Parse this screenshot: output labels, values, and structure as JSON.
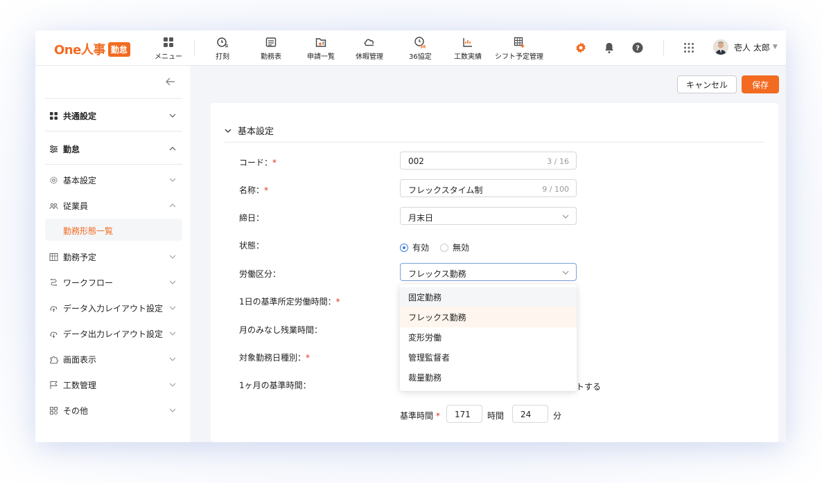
{
  "app": {
    "logo_text": "One人事",
    "logo_badge": "勤怠",
    "brand_color": "#f26b21"
  },
  "nav": {
    "menu": "メニュー",
    "items": [
      {
        "label": "打刻",
        "icon": "clock-icon"
      },
      {
        "label": "勤務表",
        "icon": "timesheet-icon"
      },
      {
        "label": "申請一覧",
        "icon": "application-list-icon"
      },
      {
        "label": "休暇管理",
        "icon": "leave-icon"
      },
      {
        "label": "36協定",
        "icon": "agreement-36-icon"
      },
      {
        "label": "工数実績",
        "icon": "workload-icon"
      },
      {
        "label": "シフト予定管理",
        "icon": "shift-icon"
      }
    ]
  },
  "user": {
    "name": "壱人 太郎"
  },
  "sidebar": {
    "groups": [
      {
        "label": "共通設定"
      },
      {
        "label": "勤怠"
      }
    ],
    "items": [
      {
        "label": "基本設定"
      },
      {
        "label": "従業員"
      },
      {
        "label": "勤務予定"
      },
      {
        "label": "ワークフロー"
      },
      {
        "label": "データ入力レイアウト設定"
      },
      {
        "label": "データ出力レイアウト設定"
      },
      {
        "label": "画面表示"
      },
      {
        "label": "工数管理"
      },
      {
        "label": "その他"
      }
    ],
    "active_subitem": "勤務形態一覧"
  },
  "toolbar": {
    "cancel_label": "キャンセル",
    "save_label": "保存"
  },
  "form": {
    "section_title": "基本設定",
    "code": {
      "label": "コード：",
      "value": "002",
      "count": "3 / 16"
    },
    "name": {
      "label": "名称：",
      "value": "フレックスタイム制",
      "count": "9 / 100"
    },
    "closing": {
      "label": "締日：",
      "value": "月末日"
    },
    "status": {
      "label": "状態：",
      "options": [
        "有効",
        "無効"
      ],
      "selected": "有効"
    },
    "labor_type": {
      "label": "労働区分：",
      "value": "フレックス勤務"
    },
    "daily_hours": {
      "label": "1日の基準所定労働時間："
    },
    "deemed_overtime": {
      "label": "月のみなし残業時間："
    },
    "target_day_type": {
      "label": "対象勤務日種別："
    },
    "monthly_base": {
      "label": "1ヶ月の基準時間：",
      "suffix_text": "トする"
    },
    "base_time": {
      "label": "基準時間",
      "hours": "171",
      "hours_unit": "時間",
      "minutes": "24",
      "minutes_unit": "分"
    }
  },
  "dropdown": {
    "options": [
      "固定勤務",
      "フレックス勤務",
      "変形労働",
      "管理監督者",
      "裁量勤務"
    ],
    "selected": "フレックス勤務",
    "hovered": "固定勤務"
  }
}
